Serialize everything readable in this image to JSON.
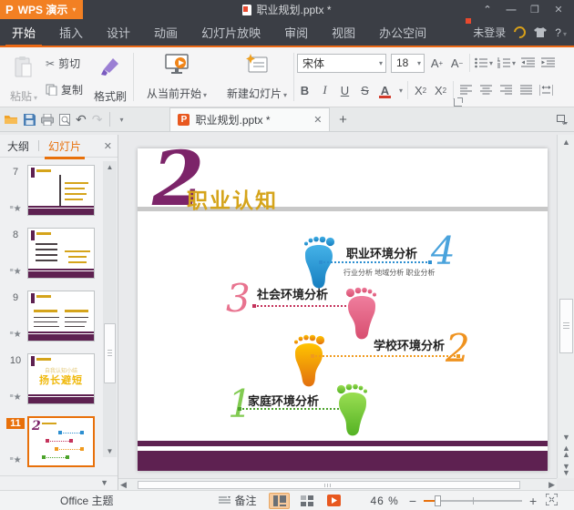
{
  "titlebar": {
    "app_name": "WPS 演示",
    "doc_title": "职业规划.pptx *",
    "window_controls": [
      "collapse",
      "minimize",
      "maximize",
      "close"
    ]
  },
  "ribbon": {
    "tabs": [
      "开始",
      "插入",
      "设计",
      "动画",
      "幻灯片放映",
      "审阅",
      "视图",
      "办公空间"
    ],
    "active_tab": "开始",
    "login_label": "未登录",
    "help_label": "?"
  },
  "toolbar": {
    "paste": "粘贴",
    "cut": "剪切",
    "copy": "复制",
    "format_painter": "格式刷",
    "play_from_current": "从当前开始",
    "new_slide": "新建幻灯片",
    "font_name": "宋体",
    "font_size": "18",
    "bold": "B",
    "italic": "I",
    "underline": "U",
    "strike": "S",
    "font_color": "A"
  },
  "doctabs": {
    "active_tab": "职业规划.pptx *"
  },
  "sidebar": {
    "outline_tab": "大纲",
    "slides_tab": "幻灯片",
    "slides": [
      {
        "number": "7"
      },
      {
        "number": "8"
      },
      {
        "number": "9"
      },
      {
        "number": "10",
        "text": "扬长避短"
      },
      {
        "number": "11",
        "selected": true
      }
    ]
  },
  "slide": {
    "section_number": "2",
    "title": "职业认知",
    "items": [
      {
        "number": "4",
        "label": "职业环境分析",
        "sub": "行业分析  地域分析  职业分析",
        "color": "#2d8fd0"
      },
      {
        "number": "3",
        "label": "社会环境分析",
        "color": "#e05a7e"
      },
      {
        "number": "2",
        "label": "学校环境分析",
        "color": "#f0931e"
      },
      {
        "number": "1",
        "label": "家庭环境分析",
        "color": "#5fb82a"
      }
    ],
    "accent_purple": "#5e2151",
    "title_gold": "#d5a41b"
  },
  "statusbar": {
    "theme": "Office 主题",
    "notes": "备注",
    "zoom": "46 %"
  }
}
